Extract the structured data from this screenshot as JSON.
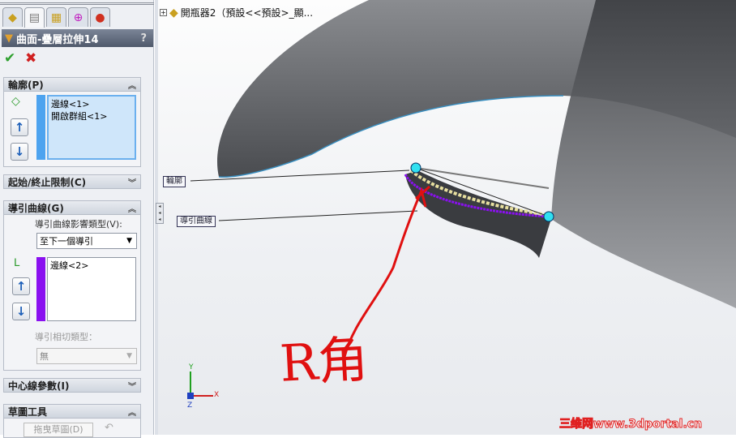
{
  "panel": {
    "tabs": [
      "feature-manager",
      "property-manager",
      "configuration-manager",
      "dimxpert-manager",
      "display-manager"
    ],
    "title": "曲面-疊層拉伸14",
    "help": "?",
    "ok_icon": "✔",
    "cancel_icon": "✖",
    "profile": {
      "header": "輪廓(P)",
      "items": [
        "邊線<1>",
        "開啟群組<1>"
      ],
      "color": "#4da3ef"
    },
    "start_end": {
      "header": "起始/終止限制(C)"
    },
    "guide": {
      "header": "導引曲線(G)",
      "influence_label": "導引曲線影響類型(V):",
      "influence_value": "至下一個導引",
      "items": [
        "邊線<2>"
      ],
      "color": "#8a10f0",
      "tangency_label": "導引相切類型：",
      "tangency_value": "無"
    },
    "centerline": {
      "header": "中心線參數(I)"
    },
    "sketch_tools": {
      "header": "草圖工具",
      "drag_button": "拖曳草圖(D)"
    }
  },
  "viewport": {
    "tree_item": "開瓶器2（預設<<預設>_顯...",
    "callout_profile": "輪廓",
    "callout_guide": "導引曲線",
    "annotation": "R角",
    "triad": {
      "x": "X",
      "y": "Y",
      "z": "Z"
    },
    "watermark": "三维网www.3dportal.cn"
  }
}
